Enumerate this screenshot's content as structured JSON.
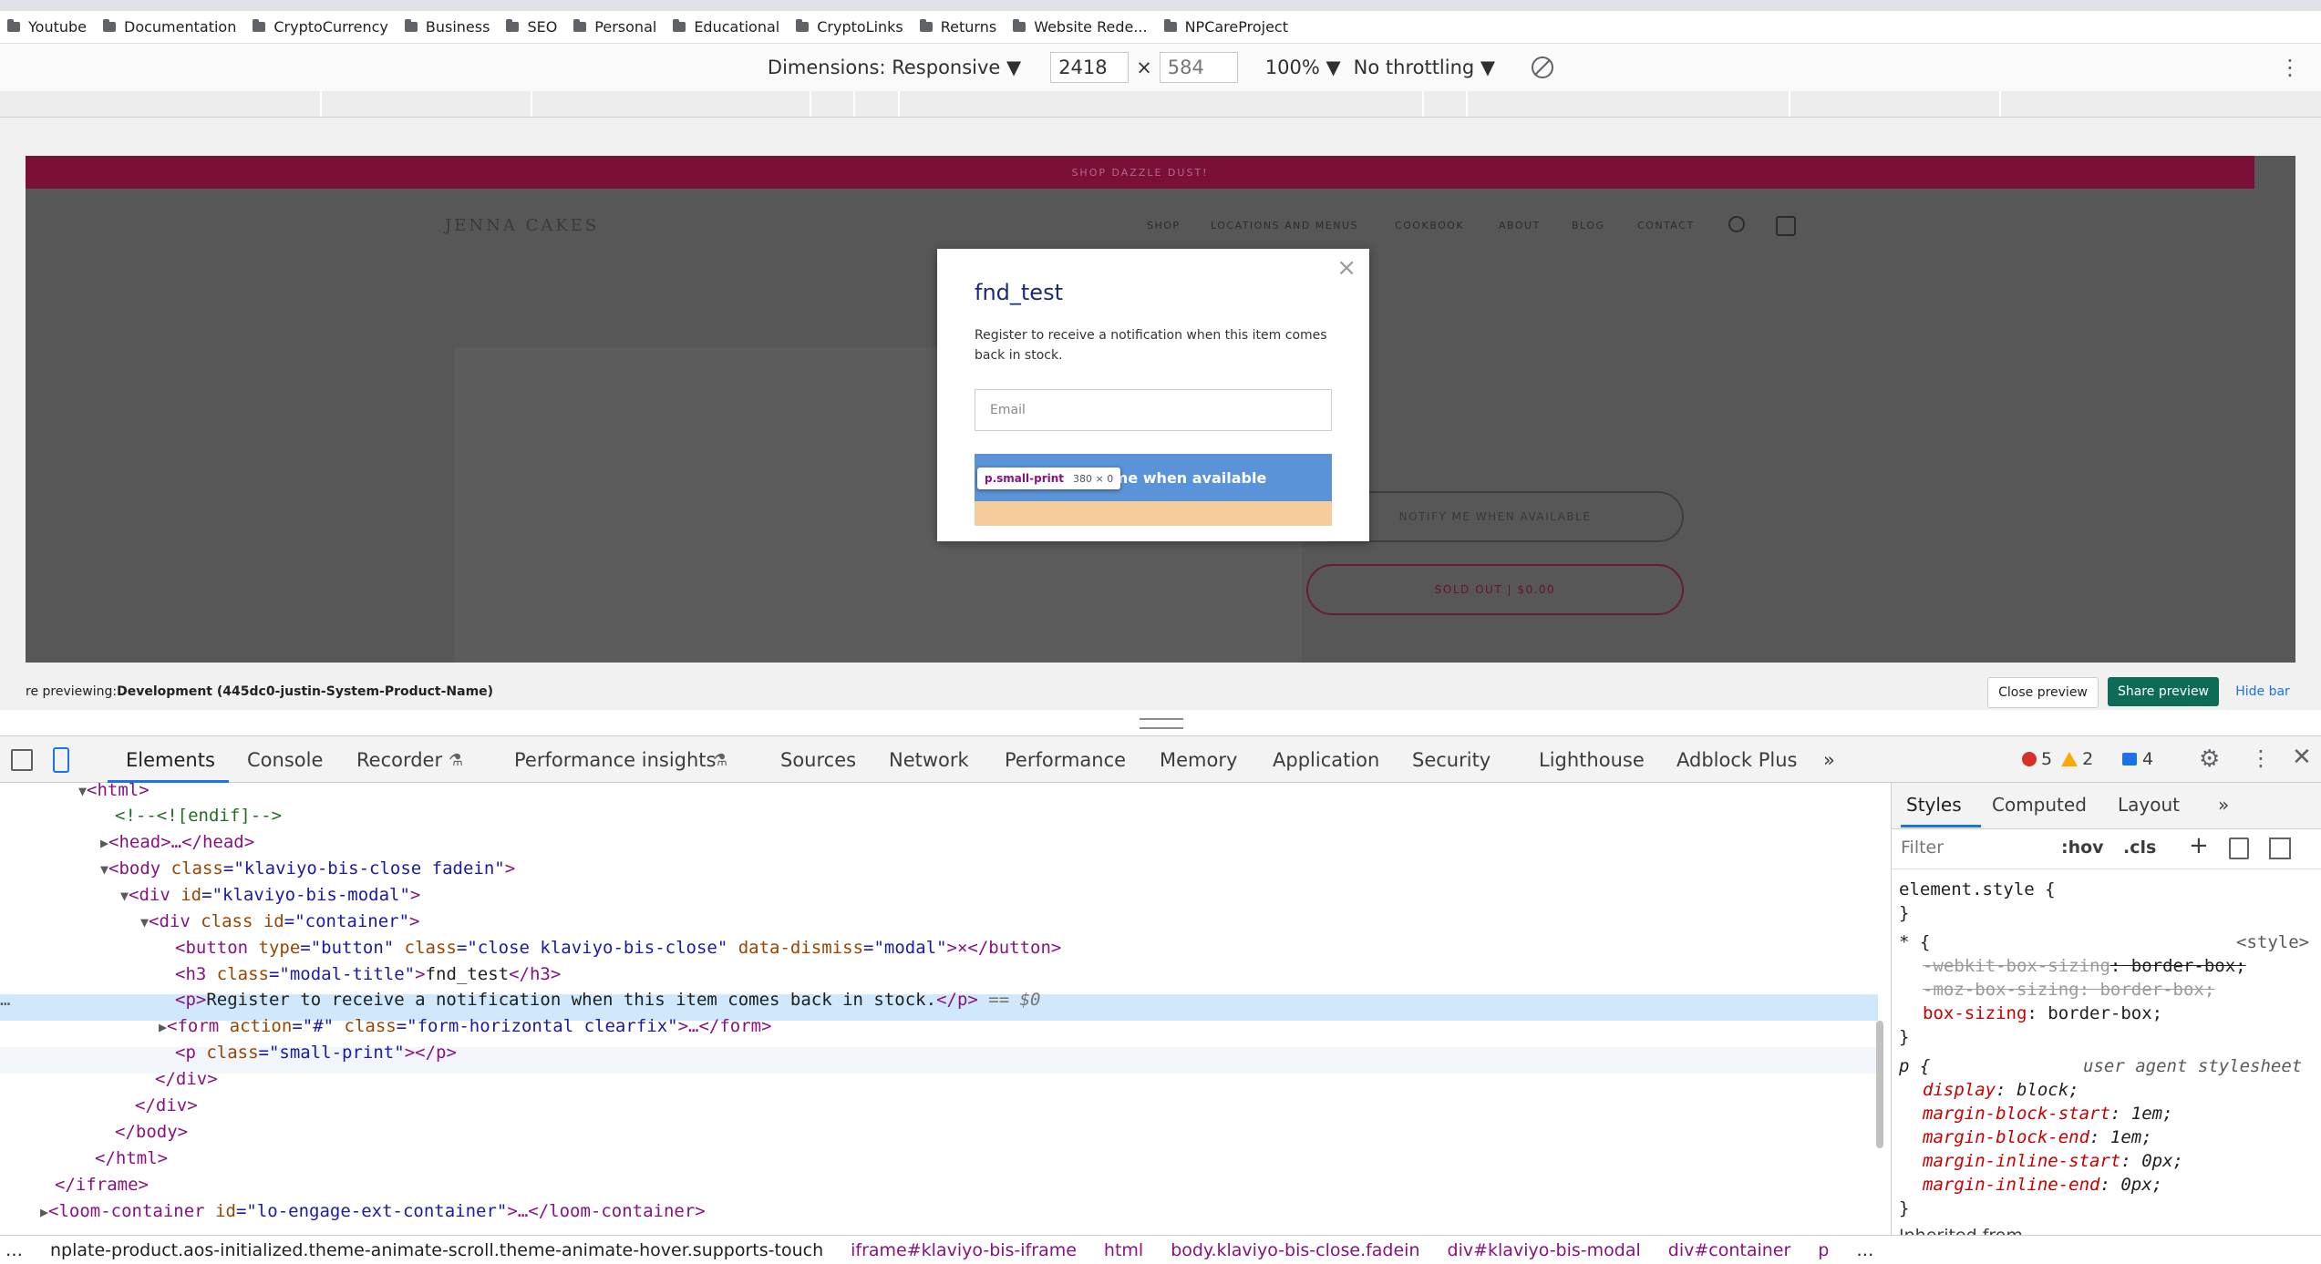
{
  "bookmarks": [
    "Youtube",
    "Documentation",
    "CryptoCurrency",
    "Business",
    "SEO",
    "Personal",
    "Educational",
    "CryptoLinks",
    "Returns",
    "Website Rede...",
    "NPCareProject"
  ],
  "device_toolbar": {
    "dimensions_label": "Dimensions: Responsive ▼",
    "width": "2418",
    "times": "×",
    "height": "584",
    "zoom": "100% ▼",
    "throttling": "No throttling ▼"
  },
  "site": {
    "promo": "SHOP DAZZLE DUST!",
    "logo": "JENNA   CAKES",
    "nav": [
      "SHOP",
      "LOCATIONS AND MENUS",
      "COOKBOOK",
      "ABOUT",
      "BLOG",
      "CONTACT"
    ],
    "notify_button": "NOTIFY ME WHEN AVAILABLE",
    "sold_out_button": "SOLD OUT | $0.00"
  },
  "modal": {
    "title": "fnd_test",
    "close": "×",
    "text": "Register to receive a notification when this item comes back in stock.",
    "email_placeholder": "Email",
    "button": "me when available",
    "tooltip_name": "p.small-print",
    "tooltip_size": "380 × 0"
  },
  "preview": {
    "prefix": "re previewing: ",
    "theme": "Development (445dc0-justin-System-Product-Name)",
    "close": "Close preview",
    "share": "Share preview",
    "hide": "Hide bar"
  },
  "devtools": {
    "tabs": [
      "Elements",
      "Console",
      "Recorder",
      "Performance insights",
      "Sources",
      "Network",
      "Performance",
      "Memory",
      "Application",
      "Security",
      "Lighthouse",
      "Adblock Plus"
    ],
    "more": "»",
    "errors": "5",
    "warnings": "2",
    "messages": "4"
  },
  "tree": {
    "l1": "<html>",
    "l2": "<!--<![endif]-->",
    "l3": "<head>…</head>",
    "l4a": "<body ",
    "l4b": "class",
    "l4c": "=\"klaviyo-bis-close fadein\"",
    "l4d": ">",
    "l5a": "<div ",
    "l5b": "id",
    "l5c": "=\"klaviyo-bis-modal\"",
    "l5d": ">",
    "l6a": "<div ",
    "l6b": "class id",
    "l6c": "=\"container\"",
    "l6d": ">",
    "l7a": "<button ",
    "l7b": "type",
    "l7c": "=\"button\" ",
    "l7d": "class",
    "l7e": "=\"close klaviyo-bis-close\" ",
    "l7f": "data-dismiss",
    "l7g": "=\"modal\"",
    "l7h": ">×</button>",
    "l8a": "<h3 ",
    "l8b": "class",
    "l8c": "=\"modal-title\"",
    "l8d": ">",
    "l8e": "fnd_test",
    "l8f": "</h3>",
    "l9a": "<p>",
    "l9b": "Register to receive a notification when this item comes back in stock.",
    "l9c": "</p>",
    "l9d": " == $0",
    "l10a": "<form ",
    "l10b": "action",
    "l10c": "=\"#\" ",
    "l10d": "class",
    "l10e": "=\"form-horizontal clearfix\"",
    "l10f": ">…</form>",
    "l11a": "<p ",
    "l11b": "class",
    "l11c": "=\"small-print\"",
    "l11d": "></p>",
    "l12": "</div>",
    "l13": "</div>",
    "l14": "</body>",
    "l15": "</html>",
    "l16": "</iframe>",
    "l17a": "<loom-container ",
    "l17b": "id",
    "l17c": "=\"lo-engage-ext-container\"",
    "l17d": ">…</loom-container>"
  },
  "styles": {
    "tabs": [
      "Styles",
      "Computed",
      "Layout"
    ],
    "more": "»",
    "filter": "Filter",
    "hov": ":hov",
    "cls": ".cls",
    "s1": "element.style {",
    "s2": "}",
    "s3": "* {",
    "s3src": "<style>",
    "s4p": "-webkit-box-sizing",
    "s4v": ": border-box;",
    "s5p": "-moz-box-sizing",
    "s5v": ": border-box;",
    "s6p": "box-sizing",
    "s6v": ": border-box;",
    "s7": "}",
    "s8": "p {",
    "s8src": "user agent stylesheet",
    "s9p": "display",
    "s9v": ": block;",
    "s10p": "margin-block-start",
    "s10v": ": 1em;",
    "s11p": "margin-block-end",
    "s11v": ": 1em;",
    "s12p": "margin-inline-start",
    "s12v": ": 0px;",
    "s13p": "margin-inline-end",
    "s13v": ": 0px;",
    "s14": "}",
    "inherited": "Inherited from ..."
  },
  "breadcrumbs": [
    "…",
    "nplate-product.aos-initialized.theme-animate-scroll.theme-animate-hover.supports-touch",
    "iframe#klaviyo-bis-iframe",
    "html",
    "body.klaviyo-bis-close.fadein",
    "div#klaviyo-bis-modal",
    "div#container",
    "p",
    "…"
  ]
}
